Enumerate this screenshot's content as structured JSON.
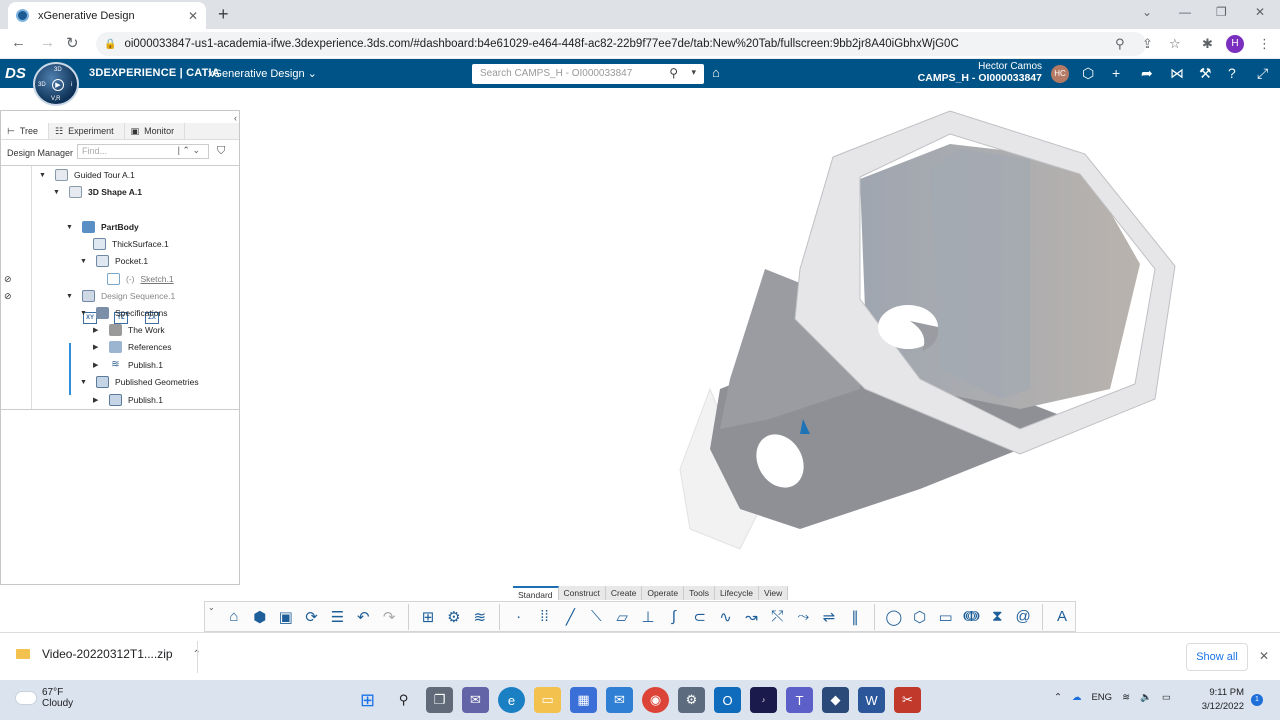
{
  "browser": {
    "tab_title": "xGenerative Design",
    "url": "oi000033847-us1-academia-ifwe.3dexperience.3ds.com/#dashboard:b4e61029-e464-448f-ac82-22b9f77ee7de/tab:New%20Tab/fullscreen:9bb2jr8A40iGbhxWjG0C",
    "profile_initial": "H"
  },
  "header": {
    "brand": "3DEXPERIENCE | CATIA",
    "app_name": "xGenerative Design",
    "search_placeholder": "Search CAMPS_H - OI000033847",
    "user_name": "Hector Camos",
    "tenant": "CAMPS_H - OI000033847",
    "user_initials": "HC",
    "compass": {
      "top": "3D",
      "left": "3D",
      "right": "i",
      "bottom": "V,R"
    }
  },
  "panel": {
    "tabs": [
      "Tree",
      "Experiment",
      "Monitor"
    ],
    "design_manager_label": "Design Manager",
    "find_placeholder": "Find...",
    "tree": {
      "root": "Guided Tour A.1",
      "shape": "3D Shape A.1",
      "planes": [
        "XY",
        "YZ",
        "ZX"
      ],
      "partbody": "PartBody",
      "thick": "ThickSurface.1",
      "pocket": "Pocket.1",
      "sketch": "Sketch.1",
      "sketch_prefix": "(-)",
      "seq": "Design Sequence.1",
      "specs": "Specifications",
      "thework": "The Work",
      "references": "References",
      "publish1": "Publish.1",
      "pubgeo": "Published Geometries",
      "publish2": "Publish.1"
    }
  },
  "actionbar": {
    "tabs": [
      "Standard",
      "Construct",
      "Create",
      "Operate",
      "Tools",
      "Lifecycle",
      "View"
    ],
    "active_tab": "Standard"
  },
  "download": {
    "file_name": "Video-20220312T1....zip",
    "show_all": "Show all"
  },
  "taskbar": {
    "temperature": "67°F",
    "condition": "Cloudy",
    "language": "ENG",
    "time": "9:11 PM",
    "date": "3/12/2022",
    "notifications": "1"
  }
}
